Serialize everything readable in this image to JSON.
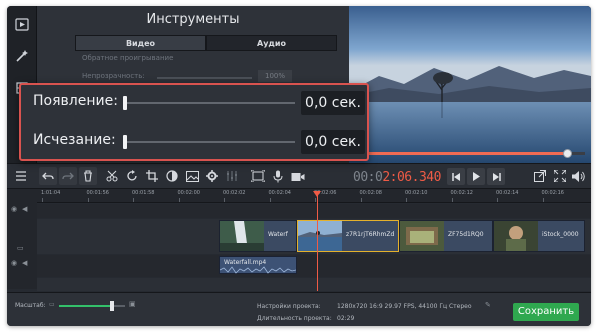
{
  "tools_panel": {
    "title": "Инструменты",
    "tabs": [
      {
        "label": "Видео",
        "active": true
      },
      {
        "label": "Аудио",
        "active": false
      }
    ],
    "reverse_label": "Обратное проигрывание",
    "opacity_label": "Непрозрачность:",
    "opacity_value": "100%"
  },
  "callout": {
    "fade_in_label": "Появление:",
    "fade_in_value": "0,0 сек.",
    "fade_out_label": "Исчезание:",
    "fade_out_value": "0,0 сек."
  },
  "preview": {
    "progress": 0.92
  },
  "toolbar": {
    "timecode_prefix": "00:0",
    "timecode_hot": "2:06.340"
  },
  "ruler": {
    "ticks": [
      "1:01:04",
      "00:01:56",
      "00:01:58",
      "00:02:00",
      "00:02:02",
      "00:02:04",
      "00:02:06",
      "00:02:08",
      "00:02:10",
      "00:02:12",
      "00:02:14",
      "00:02:16"
    ]
  },
  "timeline": {
    "clips": [
      {
        "name": "Waterf",
        "selected": false
      },
      {
        "name": "z7R1rjT6RhmZd",
        "selected": true
      },
      {
        "name": "ZF75d1RQ0",
        "selected": false
      },
      {
        "name": "iStock_0000",
        "selected": false
      }
    ],
    "audio_clip": "Waterfall.mp4"
  },
  "bottom": {
    "zoom_label": "Масштаб:",
    "zoom_level": 0.8,
    "settings_label": "Настройки проекта:",
    "settings_value": "1280x720 16:9 29.97 FPS, 44100 Гц Стерео",
    "duration_label": "Длительность проекта:",
    "duration_value": "02:29",
    "save_label": "Сохранить"
  },
  "colors": {
    "accent_red": "#ef5b46",
    "save_green": "#2fa84f",
    "selection": "#e4b12c",
    "callout_border": "#d9534f"
  }
}
